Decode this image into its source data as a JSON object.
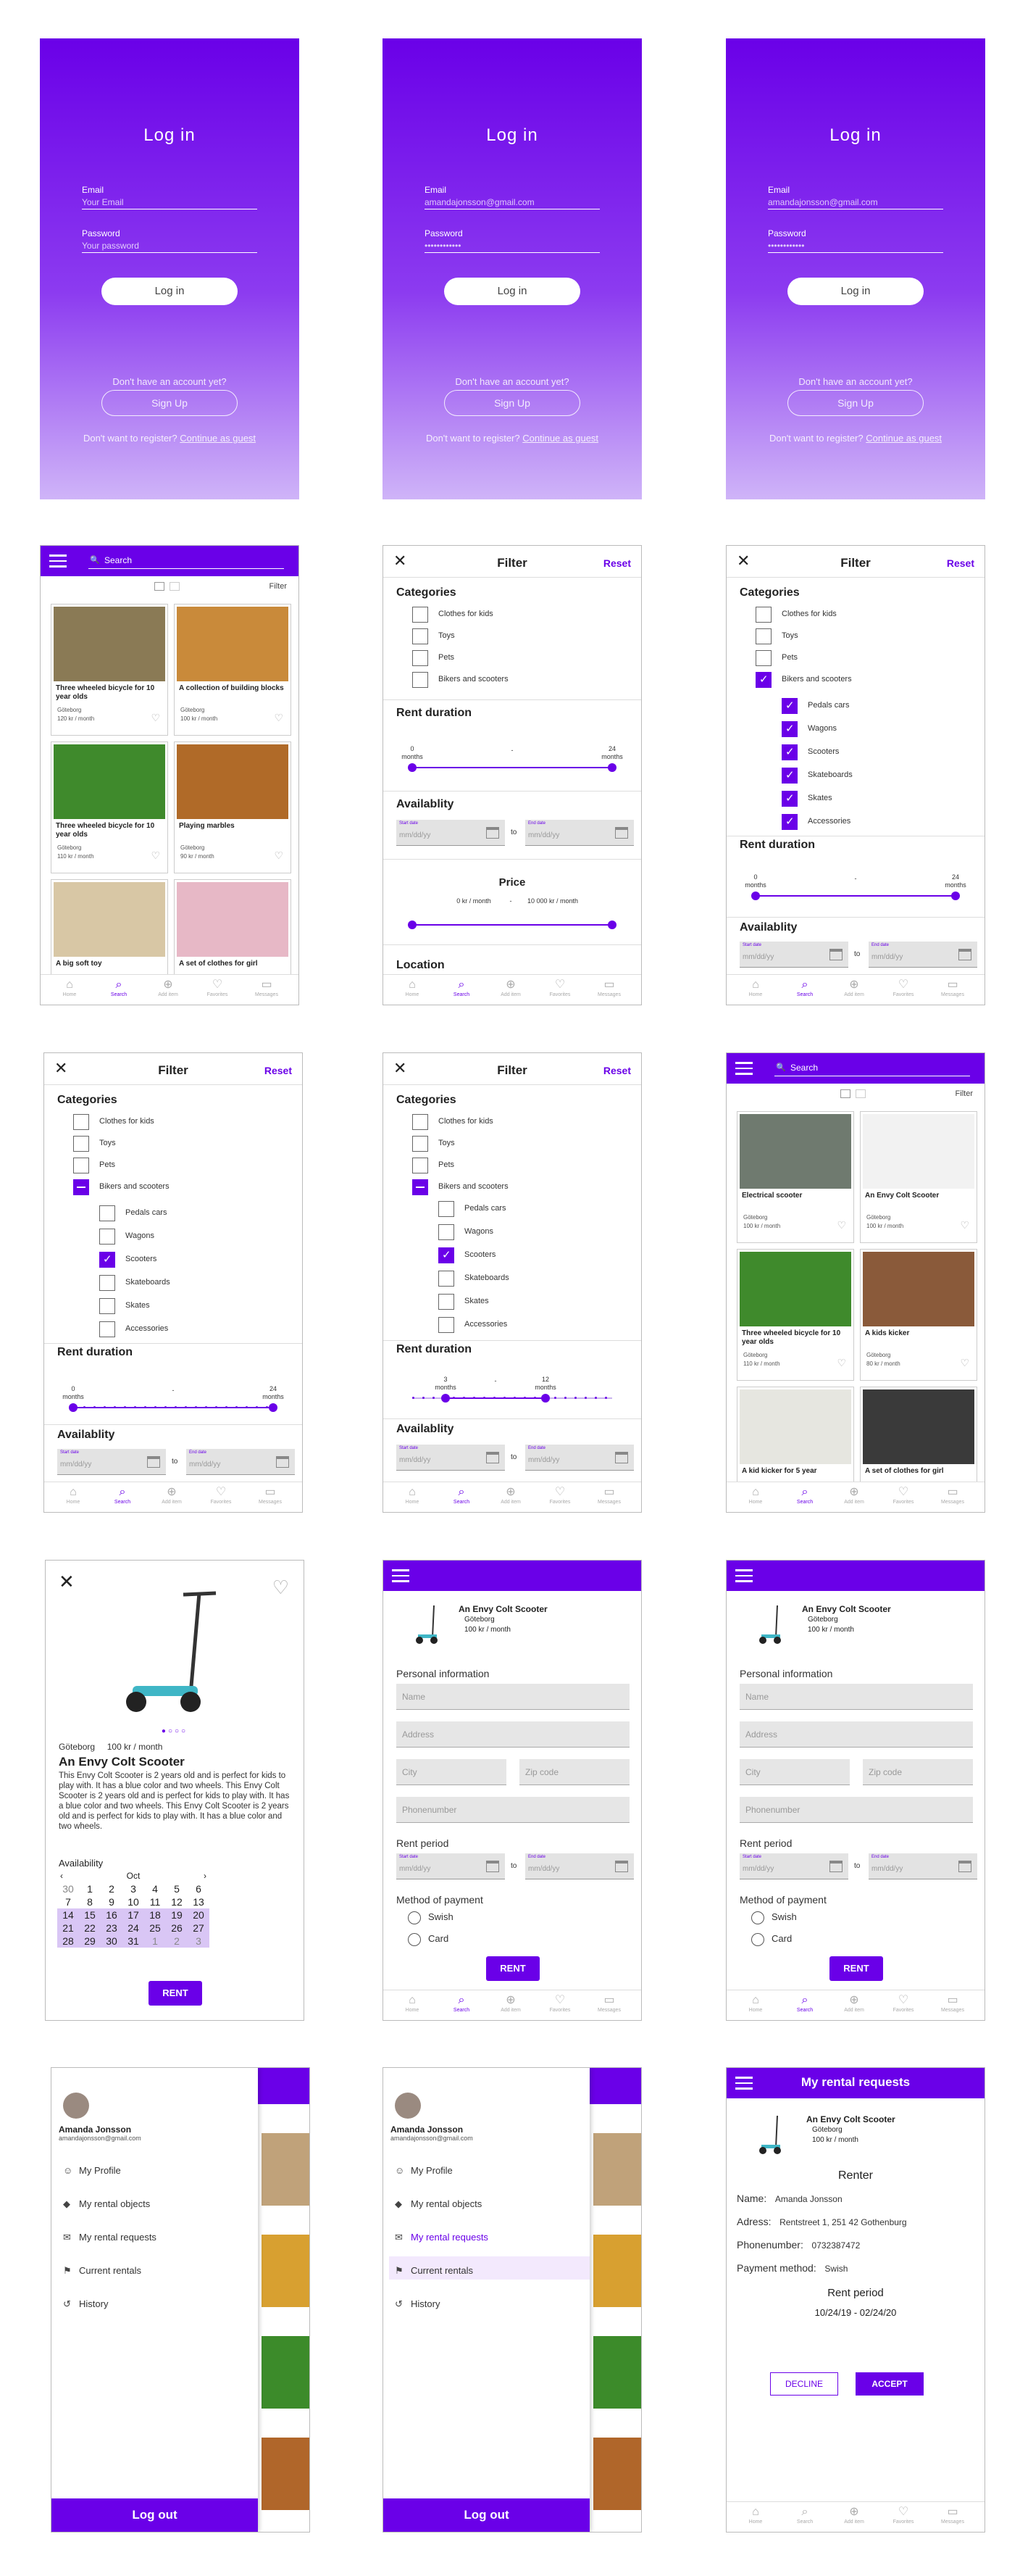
{
  "login": {
    "title": "Log in",
    "email_label": "Email",
    "password_label": "Password",
    "login_button": "Log in",
    "no_account": "Don't have an account yet?",
    "signup_button": "Sign Up",
    "no_register": "Don't want to register?",
    "guest_link": "Continue as guest",
    "screens": [
      {
        "email": "Your Email",
        "password": "Your password"
      },
      {
        "email": "amandajonsson@gmail.com",
        "password": "••••••••••••"
      },
      {
        "email": "amandajonsson@gmail.com",
        "password": "••••••••••••"
      }
    ]
  },
  "browse": {
    "search_placeholder": "Search",
    "filter_label": "Filter",
    "location": "Göteborg",
    "screen1_items": [
      {
        "title": "Three wheeled bicycle for 10 year olds",
        "price": "120 kr / month",
        "color": "#8a7a55"
      },
      {
        "title": "A collection of building blocks",
        "price": "100 kr / month",
        "color": "#c98a3a"
      },
      {
        "title": "Three wheeled bicycle for 10 year olds",
        "price": "110 kr / month",
        "color": "#3f8a2c"
      },
      {
        "title": "Playing marbles",
        "price": "90 kr / month",
        "color": "#b06a28"
      },
      {
        "title": "A big soft toy",
        "price": "",
        "color": "#d8c7a5"
      },
      {
        "title": "A set of clothes for girl",
        "price": "",
        "color": "#e7b8c6"
      }
    ],
    "screen2_items": [
      {
        "title": "Electrical scooter",
        "price": "100 kr / month",
        "color": "#6f7a6f"
      },
      {
        "title": "An Envy Colt Scooter",
        "price": "100 kr / month",
        "color": "#f2f2f2"
      },
      {
        "title": "Three wheeled bicycle for 10 year olds",
        "price": "110 kr / month",
        "color": "#3f8a2c"
      },
      {
        "title": "A kids kicker",
        "price": "80 kr / month",
        "color": "#8a5a3a"
      },
      {
        "title": "A kid kicker for 5 year",
        "price": "",
        "color": "#e6e6e0"
      },
      {
        "title": "A set of clothes for girl",
        "price": "",
        "color": "#3a3a3a"
      }
    ]
  },
  "tabs": [
    "Home",
    "Search",
    "Add item",
    "Favorites",
    "Messages"
  ],
  "filter": {
    "title": "Filter",
    "reset": "Reset",
    "categories_title": "Categories",
    "categories": [
      "Clothes for kids",
      "Toys",
      "Pets",
      "Bikers and scooters"
    ],
    "subcategories": [
      "Pedals cars",
      "Wagons",
      "Scooters",
      "Skateboards",
      "Skates",
      "Accessories"
    ],
    "rent_duration_title": "Rent duration",
    "min_label": "0",
    "max_label": "24",
    "min_label_b": "3",
    "max_label_b": "12",
    "months": "months",
    "availability_title": "Availablity",
    "start_label": "Start date",
    "end_label": "End date",
    "date_placeholder": "mm/dd/yy",
    "to": "to",
    "price_title": "Price",
    "price_min": "0 kr / month",
    "price_max": "10 000 kr / month",
    "location_title": "Location"
  },
  "detail": {
    "location": "Göteborg",
    "price": "100 kr / month",
    "title": "An Envy Colt Scooter",
    "description": "This Envy Colt Scooter is 2 years old and is perfect for kids to play with. It has a blue color and two wheels. This Envy Colt Scooter is 2 years old and is perfect for kids to play with. It has a blue color and two wheels. This Envy Colt Scooter is 2 years old and is perfect for kids to play with. It has a blue color and two wheels.",
    "availability_title": "Availability",
    "month": "Oct",
    "calendar": [
      [
        "30",
        "1",
        "2",
        "3",
        "4",
        "5",
        "6"
      ],
      [
        "7",
        "8",
        "9",
        "10",
        "11",
        "12",
        "13"
      ],
      [
        "14",
        "15",
        "16",
        "17",
        "18",
        "19",
        "20"
      ],
      [
        "21",
        "22",
        "23",
        "24",
        "25",
        "26",
        "27"
      ],
      [
        "28",
        "29",
        "30",
        "31",
        "1",
        "2",
        "3"
      ]
    ],
    "rent_button": "RENT"
  },
  "rent_form": {
    "item_title": "An Envy Colt Scooter",
    "item_location": "Göteborg",
    "item_price": "100 kr / month",
    "personal_info": "Personal information",
    "name": "Name",
    "address": "Address",
    "city": "City",
    "zip": "Zip code",
    "phone": "Phonenumber",
    "rent_period": "Rent period",
    "payment_method": "Method of payment",
    "swish": "Swish",
    "card": "Card",
    "rent_button": "RENT"
  },
  "menu": {
    "user_name": "Amanda Jonsson",
    "user_email": "amandajonsson@gmail.com",
    "items": [
      "My Profile",
      "My rental objects",
      "My rental requests",
      "Current rentals",
      "History"
    ],
    "logout": "Log out"
  },
  "requests": {
    "title": "My rental requests",
    "item_title": "An Envy Colt Scooter",
    "item_location": "Göteborg",
    "item_price": "100 kr / month",
    "renter_title": "Renter",
    "name_label": "Name:",
    "name_value": "Amanda Jonsson",
    "address_label": "Adress:",
    "address_value": "Rentstreet 1,  251 42 Gothenburg",
    "phone_label": "Phonenumber:",
    "phone_value": "0732387472",
    "payment_label": "Payment method:",
    "payment_value": "Swish",
    "rent_period_title": "Rent period",
    "start": "10/24/19",
    "end": "02/24/20",
    "decline": "DECLINE",
    "accept": "ACCEPT"
  },
  "colors": {
    "accent": "#6a00e8",
    "accent_light": "#d9c6f5"
  }
}
